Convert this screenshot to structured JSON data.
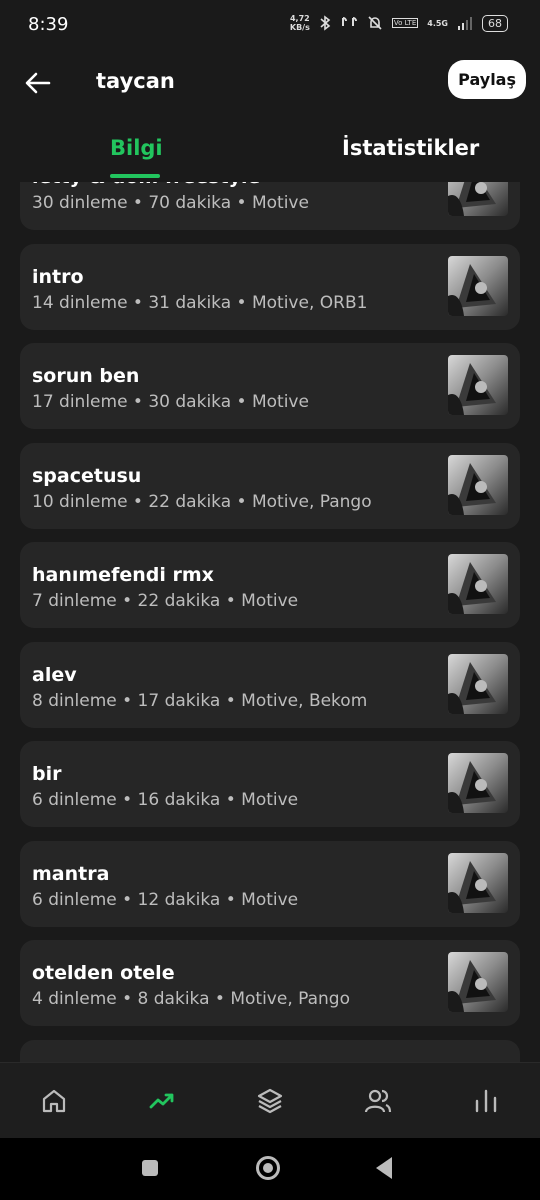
{
  "status": {
    "time": "8:39",
    "net_speed_value": "4,72",
    "net_speed_unit": "KB/s",
    "volte": "Vo LTE",
    "signal": "4.5G",
    "battery": "68"
  },
  "header": {
    "title": "taycan",
    "share_label": "Paylaş"
  },
  "tabs": [
    {
      "label": "Bilgi",
      "active": true
    },
    {
      "label": "İstatistikler",
      "active": false
    }
  ],
  "colors": {
    "accent": "#22c55e",
    "card": "#262626",
    "background": "#1a1a1a"
  },
  "tracks": [
    {
      "title": "letty & dom freestyle",
      "subtitle": "30 dinleme • 70 dakika • Motive"
    },
    {
      "title": "intro",
      "subtitle": "14 dinleme • 31 dakika • Motive, ORB1"
    },
    {
      "title": "sorun ben",
      "subtitle": "17 dinleme • 30 dakika • Motive"
    },
    {
      "title": "spacetusu",
      "subtitle": "10 dinleme • 22 dakika • Motive, Pango"
    },
    {
      "title": "hanımefendi rmx",
      "subtitle": "7 dinleme • 22 dakika • Motive"
    },
    {
      "title": "alev",
      "subtitle": "8 dinleme • 17 dakika • Motive, Bekom"
    },
    {
      "title": "bir",
      "subtitle": "6 dinleme • 16 dakika • Motive"
    },
    {
      "title": "mantra",
      "subtitle": "6 dinleme • 12 dakika • Motive"
    },
    {
      "title": "otelden otele",
      "subtitle": "4 dinleme • 8 dakika • Motive, Pango"
    },
    {
      "title": "",
      "subtitle": ""
    }
  ],
  "bottom_nav": [
    {
      "icon": "home-icon"
    },
    {
      "icon": "trending-icon",
      "active": true
    },
    {
      "icon": "layers-icon"
    },
    {
      "icon": "friends-icon"
    },
    {
      "icon": "bar-chart-icon"
    }
  ]
}
